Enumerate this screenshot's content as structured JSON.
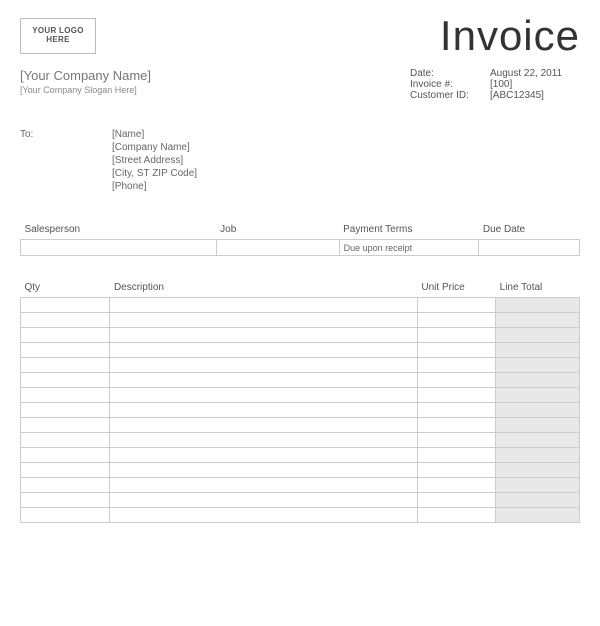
{
  "header": {
    "logo_text": "YOUR LOGO HERE",
    "title": "Invoice"
  },
  "company": {
    "name": "[Your Company Name]",
    "slogan": "[Your Company Slogan Here]"
  },
  "meta": {
    "date_label": "Date:",
    "date_value": "August 22, 2011",
    "invoice_no_label": "Invoice #:",
    "invoice_no_value": "[100]",
    "customer_id_label": "Customer ID:",
    "customer_id_value": "[ABC12345]"
  },
  "billto": {
    "label": "To:",
    "name": "[Name]",
    "company": "[Company Name]",
    "street": "[Street Address]",
    "city": "[City, ST  ZIP Code]",
    "phone": "[Phone]"
  },
  "jobinfo": {
    "headers": {
      "salesperson": "Salesperson",
      "job": "Job",
      "payment_terms": "Payment Terms",
      "due_date": "Due Date"
    },
    "values": {
      "salesperson": "",
      "job": "",
      "payment_terms": "Due upon receipt",
      "due_date": ""
    }
  },
  "items": {
    "headers": {
      "qty": "Qty",
      "description": "Description",
      "unit_price": "Unit Price",
      "line_total": "Line Total"
    },
    "row_count": 15
  }
}
